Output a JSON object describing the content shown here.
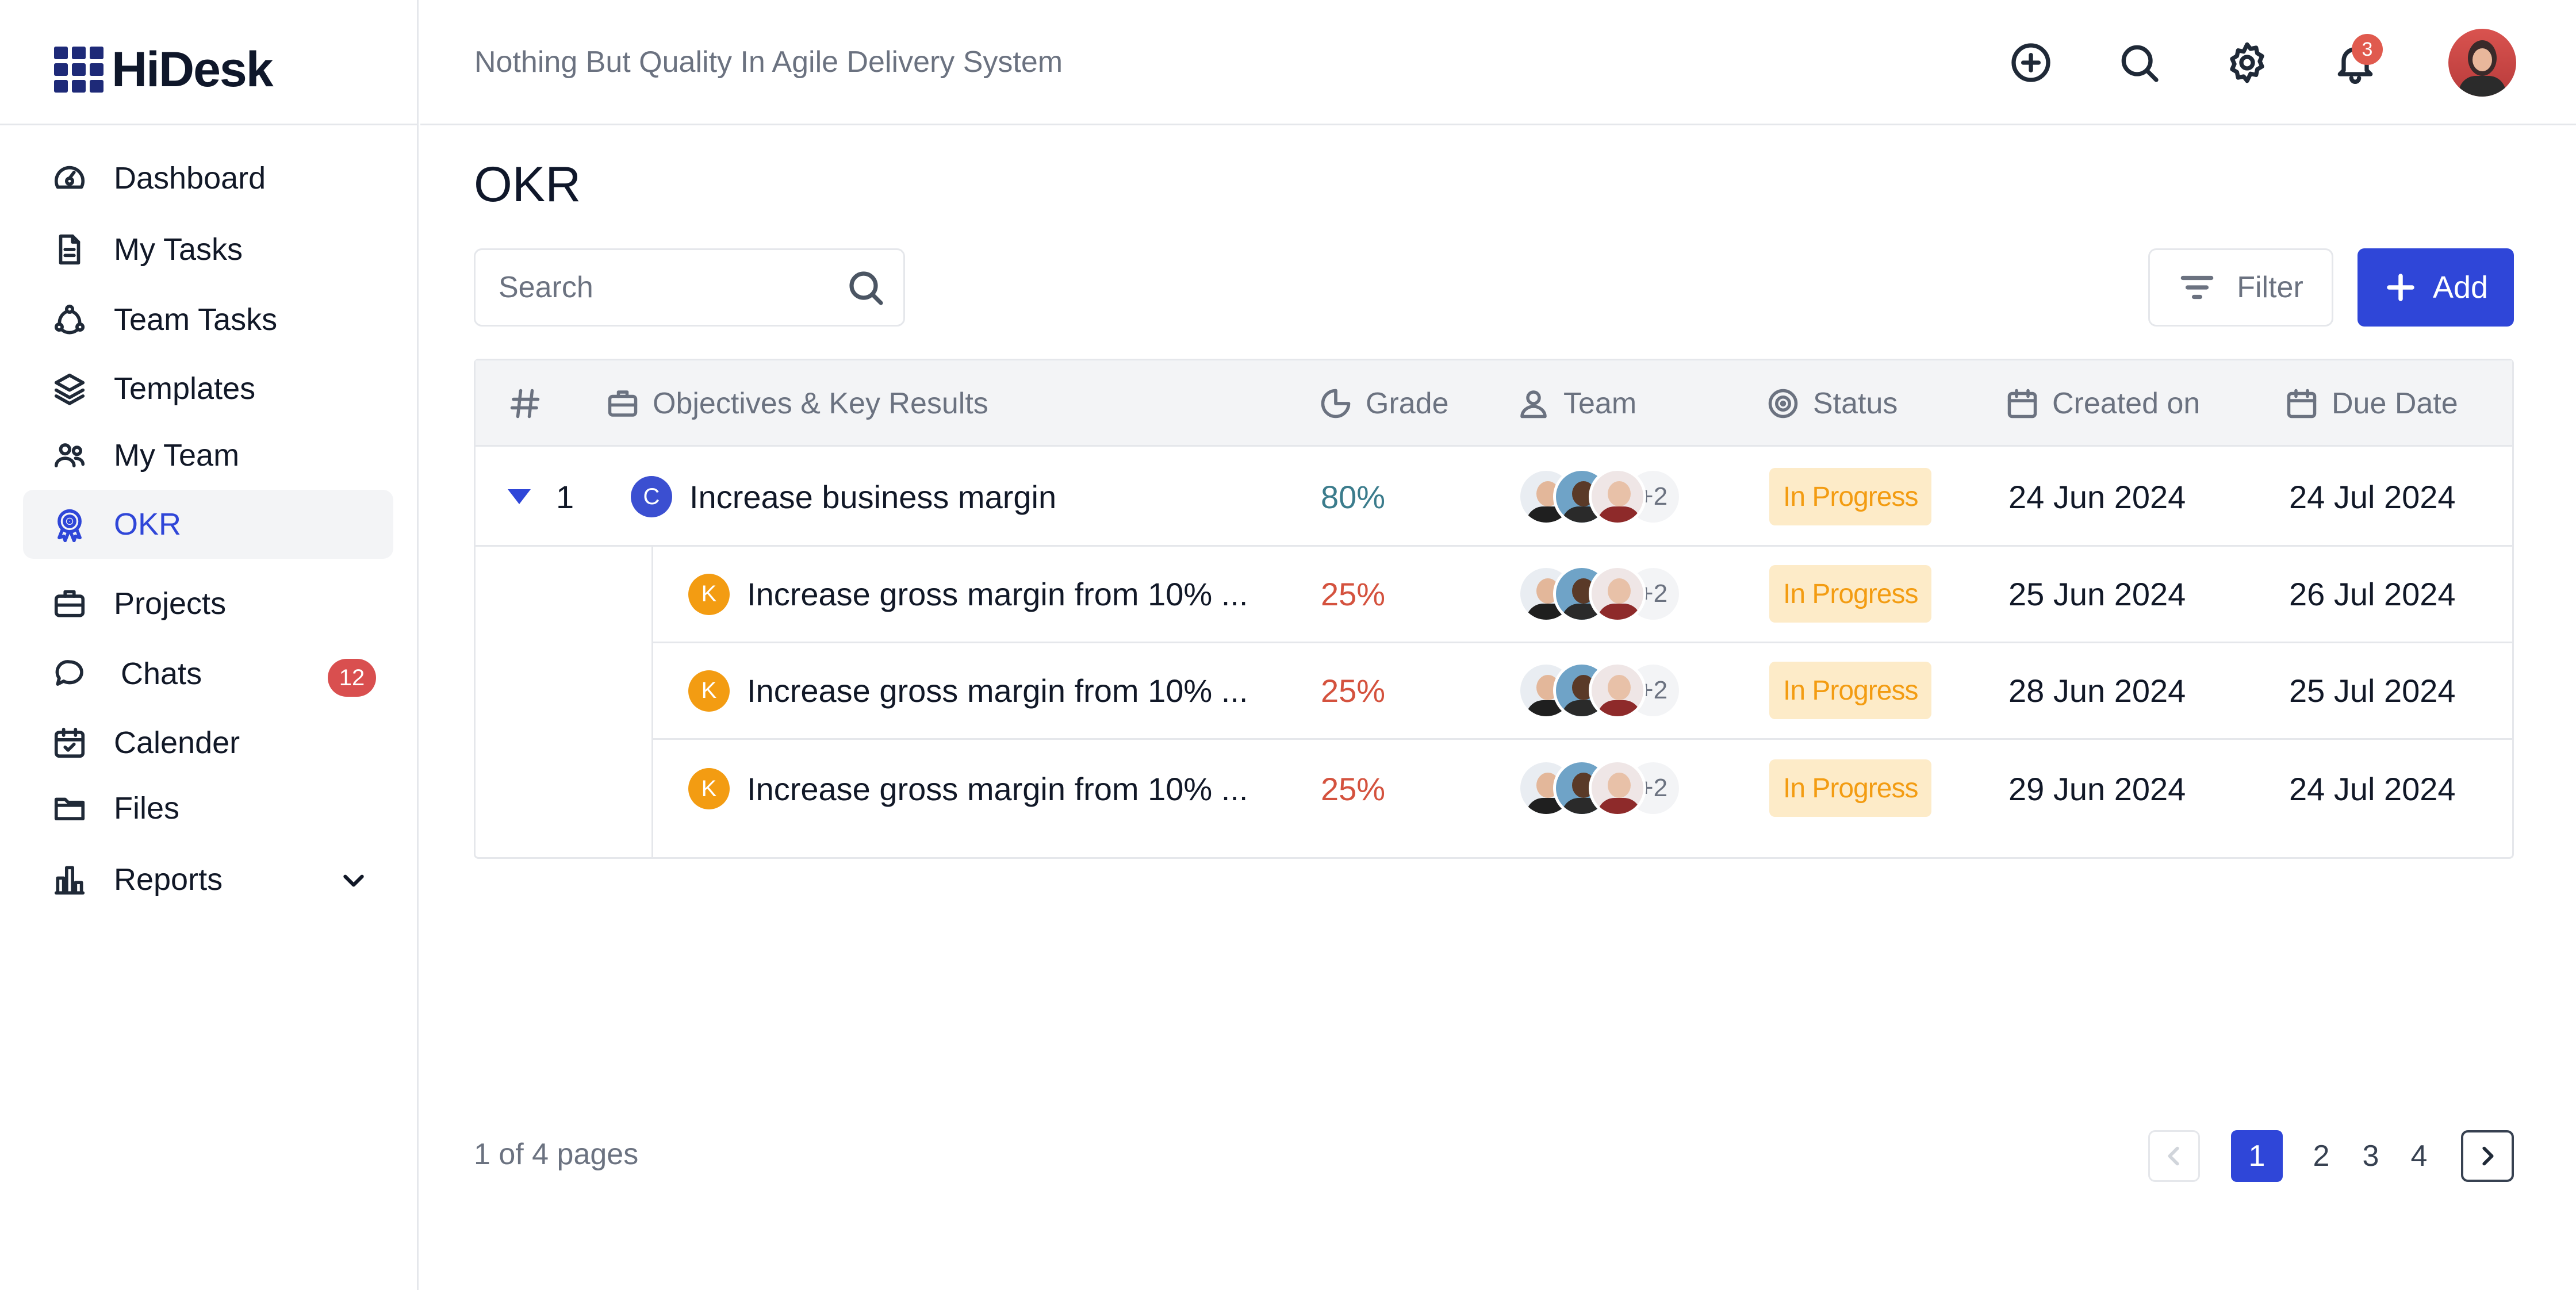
{
  "app": {
    "name": "HiDesk",
    "tagline": "Nothing But Quality In Agile Delivery System"
  },
  "header": {
    "notifications_count": "3",
    "icons": [
      "plus-circle-icon",
      "search-icon",
      "gear-icon",
      "bell-icon"
    ]
  },
  "sidebar": {
    "items": [
      {
        "label": "Dashboard",
        "icon": "dashboard-icon"
      },
      {
        "label": "My Tasks",
        "icon": "document-icon"
      },
      {
        "label": "Team Tasks",
        "icon": "team-tasks-icon"
      },
      {
        "label": "Templates",
        "icon": "layers-icon"
      },
      {
        "label": "My Team",
        "icon": "users-icon"
      },
      {
        "label": "OKR",
        "icon": "target-icon",
        "active": true
      },
      {
        "label": "Projects",
        "icon": "briefcase-icon"
      },
      {
        "label": "Chats",
        "icon": "chat-icon",
        "badge": "12"
      },
      {
        "label": "Calender",
        "icon": "calendar-icon"
      },
      {
        "label": "Files",
        "icon": "folder-icon"
      },
      {
        "label": "Reports",
        "icon": "bar-chart-icon",
        "expandable": true
      }
    ]
  },
  "main": {
    "title": "OKR",
    "search": {
      "placeholder": "Search"
    },
    "filter_label": "Filter",
    "add_label": "Add",
    "table": {
      "columns": [
        "#",
        "Objectives & Key Results",
        "Grade",
        "Team",
        "Status",
        "Created on",
        "Due Date"
      ],
      "objective": {
        "num": "1",
        "badge": "C",
        "title": "Increase business margin",
        "grade": "80%",
        "team_more": "+2",
        "status": "In Progress",
        "created": "24 Jun 2024",
        "due": "24 Jul 2024"
      },
      "key_results": [
        {
          "badge": "K",
          "title": "Increase gross margin from 10% ...",
          "grade": "25%",
          "team_more": "+2",
          "status": "In Progress",
          "created": "25 Jun 2024",
          "due": "26 Jul 2024"
        },
        {
          "badge": "K",
          "title": "Increase gross margin from 10% ...",
          "grade": "25%",
          "team_more": "+2",
          "status": "In Progress",
          "created": "28 Jun 2024",
          "due": "25 Jul 2024"
        },
        {
          "badge": "K",
          "title": "Increase gross margin from 10% ...",
          "grade": "25%",
          "team_more": "+2",
          "status": "In Progress",
          "created": "29 Jun 2024",
          "due": "24 Jul 2024"
        }
      ]
    }
  },
  "pagination": {
    "info": "1 of 4 pages",
    "pages": [
      "1",
      "2",
      "3",
      "4"
    ],
    "current": "1"
  },
  "colors": {
    "accent": "#2F46D8",
    "grade_good": "#3B7C8C",
    "grade_low": "#D4523E",
    "status_text": "#F39C12",
    "status_bg": "#FDEBC8",
    "key_badge": "#F39C12",
    "badge_red": "#D94F4F"
  }
}
